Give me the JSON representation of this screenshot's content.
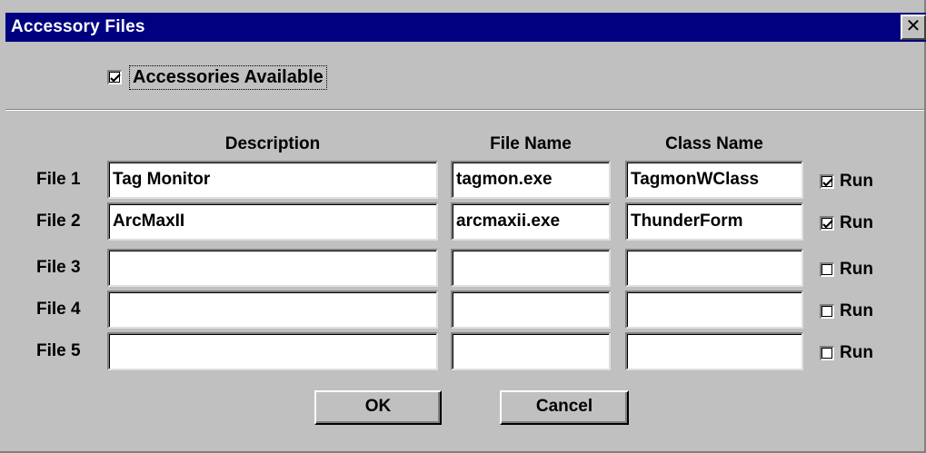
{
  "window": {
    "title": "Accessory Files",
    "close_glyph": "✕"
  },
  "accessories_available": {
    "label": "Accessories Available",
    "checked": true
  },
  "headers": {
    "description": "Description",
    "file_name": "File Name",
    "class_name": "Class Name"
  },
  "rows": [
    {
      "label": "File 1",
      "description": "Tag Monitor",
      "file_name": "tagmon.exe",
      "class_name": "TagmonWClass",
      "run_label": "Run",
      "run": true
    },
    {
      "label": "File 2",
      "description": "ArcMaxII",
      "file_name": "arcmaxii.exe",
      "class_name": "ThunderForm",
      "run_label": "Run",
      "run": true
    },
    {
      "label": "File 3",
      "description": "",
      "file_name": "",
      "class_name": "",
      "run_label": "Run",
      "run": false
    },
    {
      "label": "File 4",
      "description": "",
      "file_name": "",
      "class_name": "",
      "run_label": "Run",
      "run": false
    },
    {
      "label": "File 5",
      "description": "",
      "file_name": "",
      "class_name": "",
      "run_label": "Run",
      "run": false
    }
  ],
  "buttons": {
    "ok": "OK",
    "cancel": "Cancel"
  },
  "colors": {
    "titlebar": "#000080",
    "face": "#c0c0c0"
  }
}
